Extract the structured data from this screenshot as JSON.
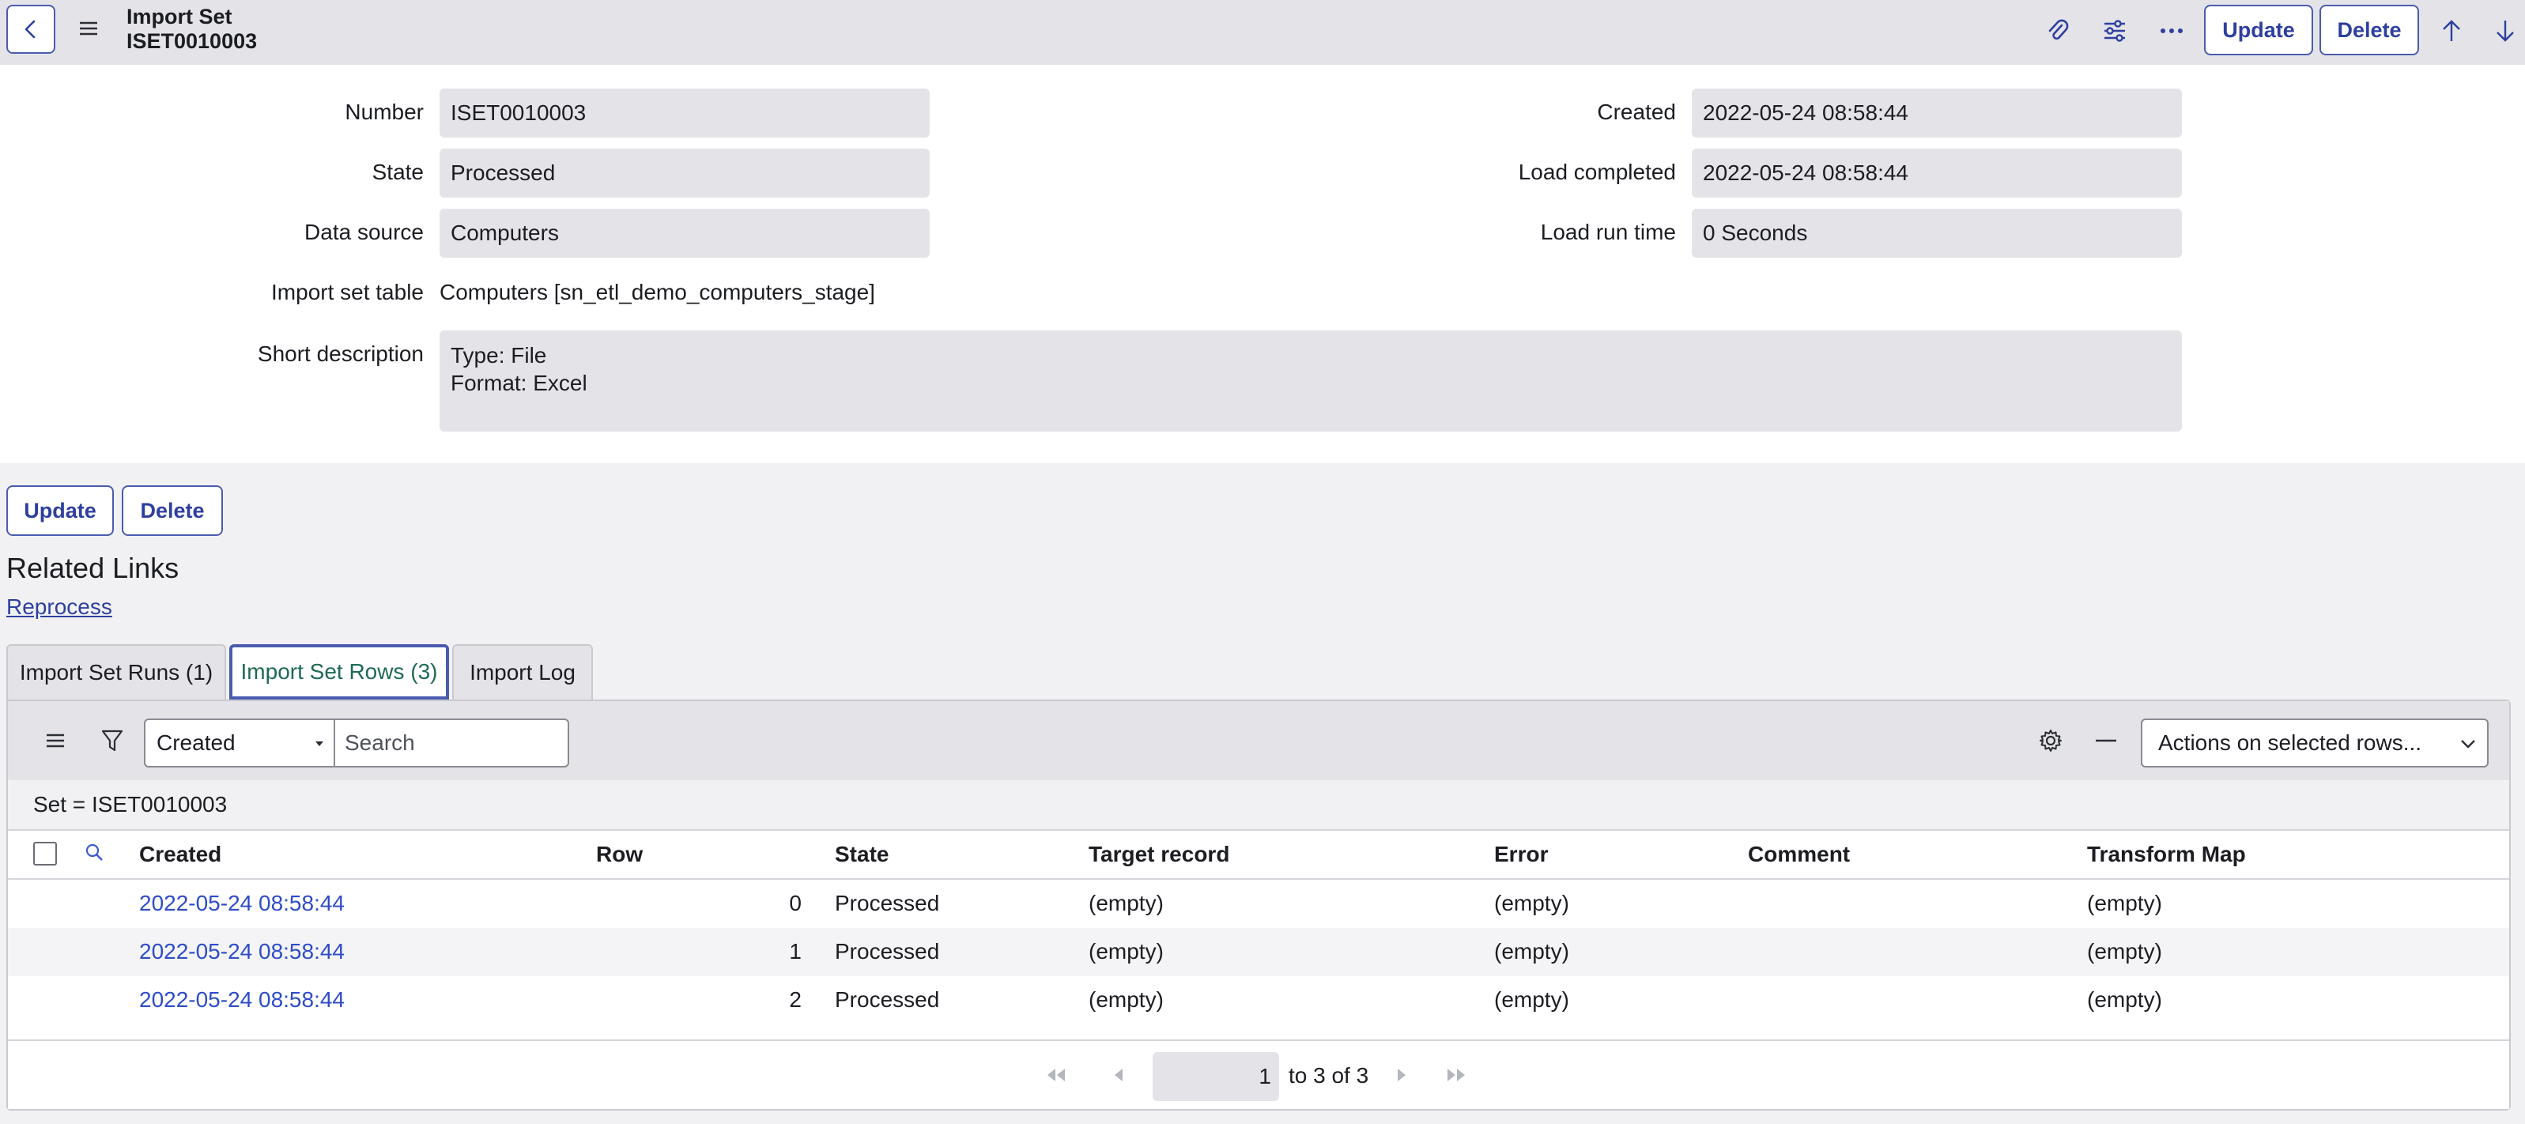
{
  "header": {
    "title": "Import Set",
    "record_number": "ISET0010003",
    "update_label": "Update",
    "delete_label": "Delete",
    "icons": [
      "back-icon",
      "menu-icon",
      "paperclip-icon",
      "sliders-icon",
      "more-icon",
      "arrow-up-icon",
      "arrow-down-icon"
    ]
  },
  "form": {
    "number_label": "Number",
    "number_value": "ISET0010003",
    "state_label": "State",
    "state_value": "Processed",
    "data_source_label": "Data source",
    "data_source_value": "Computers",
    "import_set_table_label": "Import set table",
    "import_set_table_value": "Computers [sn_etl_demo_computers_stage]",
    "short_description_label": "Short description",
    "short_description_line1": "Type: File",
    "short_description_line2": "Format: Excel",
    "created_label": "Created",
    "created_value": "2022-05-24 08:58:44",
    "load_completed_label": "Load completed",
    "load_completed_value": "2022-05-24 08:58:44",
    "load_run_time_label": "Load run time",
    "load_run_time_value": "0 Seconds"
  },
  "bottom_actions": {
    "update_label": "Update",
    "delete_label": "Delete"
  },
  "related_links": {
    "title": "Related Links",
    "reprocess_label": "Reprocess"
  },
  "tabs": [
    {
      "label": "Import Set Runs (1)",
      "active": false
    },
    {
      "label": "Import Set Rows (3)",
      "active": true
    },
    {
      "label": "Import Log",
      "active": false
    }
  ],
  "list": {
    "field_select_value": "Created",
    "search_placeholder": "Search",
    "actions_select_value": "Actions on selected rows...",
    "breadcrumb": "Set = ISET0010003",
    "columns": [
      "Created",
      "Row",
      "State",
      "Target record",
      "Error",
      "Comment",
      "Transform Map"
    ],
    "rows": [
      {
        "created": "2022-05-24 08:58:44",
        "row": "0",
        "state": "Processed",
        "target_record": "(empty)",
        "error": "(empty)",
        "comment": "",
        "transform_map": "(empty)"
      },
      {
        "created": "2022-05-24 08:58:44",
        "row": "1",
        "state": "Processed",
        "target_record": "(empty)",
        "error": "(empty)",
        "comment": "",
        "transform_map": "(empty)"
      },
      {
        "created": "2022-05-24 08:58:44",
        "row": "2",
        "state": "Processed",
        "target_record": "(empty)",
        "error": "(empty)",
        "comment": "",
        "transform_map": "(empty)"
      }
    ],
    "pager": {
      "current": "1",
      "range_text": "to 3 of 3"
    }
  },
  "colors": {
    "accent": "#4a5bb0",
    "link": "#2e4cc8",
    "active_tab_text": "#1e6b4f",
    "field_bg": "#e4e4e8"
  }
}
